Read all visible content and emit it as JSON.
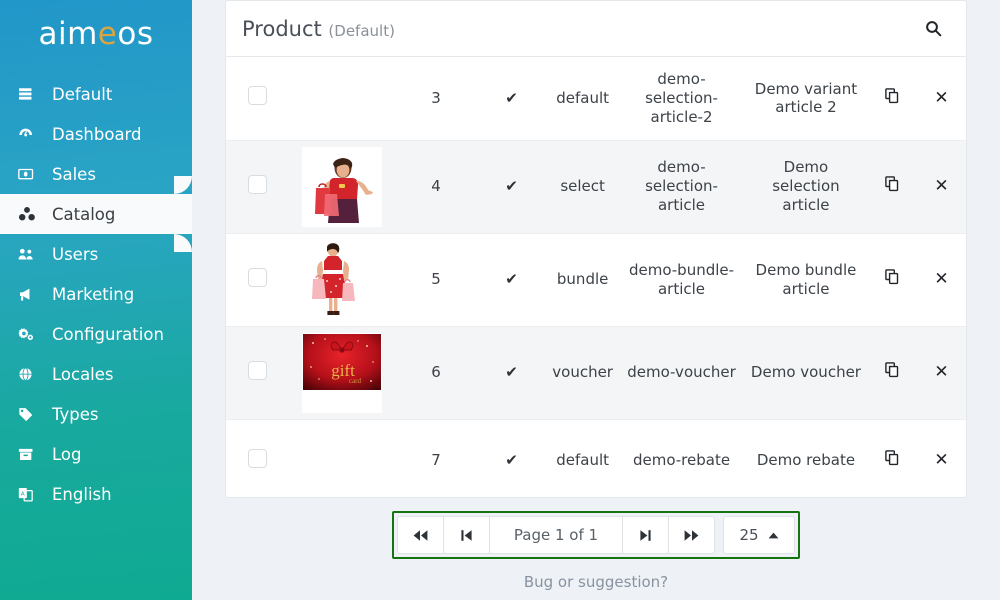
{
  "brand": {
    "text_before": "aim",
    "accent_letter": "e",
    "text_after": "os",
    "accent_color": "#d9a441"
  },
  "sidebar": {
    "items": [
      {
        "label": "Default",
        "icon": "server-icon",
        "active": false
      },
      {
        "label": "Dashboard",
        "icon": "dashboard-icon",
        "active": false
      },
      {
        "label": "Sales",
        "icon": "money-icon",
        "active": false
      },
      {
        "label": "Catalog",
        "icon": "catalog-icon",
        "active": true
      },
      {
        "label": "Users",
        "icon": "users-icon",
        "active": false
      },
      {
        "label": "Marketing",
        "icon": "megaphone-icon",
        "active": false
      },
      {
        "label": "Configuration",
        "icon": "gears-icon",
        "active": false
      },
      {
        "label": "Locales",
        "icon": "globe-icon",
        "active": false
      },
      {
        "label": "Types",
        "icon": "tag-icon",
        "active": false
      },
      {
        "label": "Log",
        "icon": "archive-icon",
        "active": false
      },
      {
        "label": "English",
        "icon": "language-icon",
        "active": false
      }
    ]
  },
  "panel": {
    "title": "Product",
    "subtitle": "(Default)",
    "search_icon": "search-icon"
  },
  "table": {
    "rows": [
      {
        "id": "3",
        "status": "✔",
        "type": "default",
        "code": "demo-selection-article-2",
        "label": "Demo variant article 2",
        "image": "none",
        "alt": false
      },
      {
        "id": "4",
        "status": "✔",
        "type": "select",
        "code": "demo-selection-article",
        "label": "Demo selection article",
        "image": "woman-bags",
        "alt": true
      },
      {
        "id": "5",
        "status": "✔",
        "type": "bundle",
        "code": "demo-bundle-article",
        "label": "Demo bundle article",
        "image": "woman-dress",
        "alt": false
      },
      {
        "id": "6",
        "status": "✔",
        "type": "voucher",
        "code": "demo-voucher",
        "label": "Demo voucher",
        "image": "gift-card",
        "alt": true
      },
      {
        "id": "7",
        "status": "✔",
        "type": "default",
        "code": "demo-rebate",
        "label": "Demo rebate",
        "image": "none",
        "alt": false
      }
    ],
    "copy_icon": "copy-icon",
    "delete_icon": "close-icon",
    "gift_card_text": "gift",
    "gift_card_sub": "card"
  },
  "pagination": {
    "first_label": "⏮",
    "prev_label": "◀",
    "page_text": "Page 1 of 1",
    "next_label": "▶",
    "last_label": "⏭",
    "per_page_value": "25",
    "per_page_caret": "▲",
    "highlight_color": "#17730f"
  },
  "footer": {
    "note": "Bug or suggestion?"
  }
}
